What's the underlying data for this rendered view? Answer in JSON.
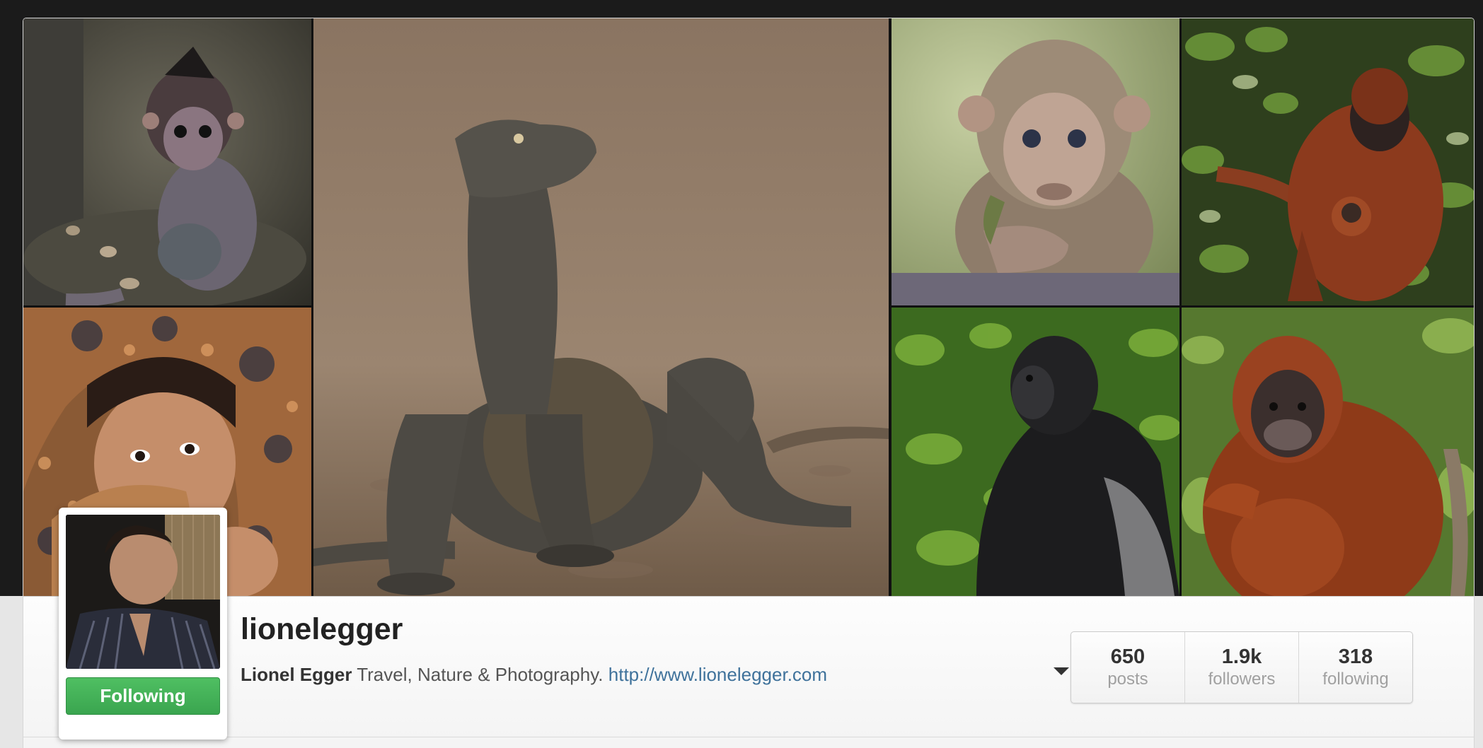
{
  "profile": {
    "username": "lionelegger",
    "full_name": "Lionel Egger",
    "bio": "Travel, Nature & Photography.",
    "website": "http://www.lionelegger.com",
    "follow_state": "Following"
  },
  "stats": [
    {
      "value": "650",
      "label": "posts"
    },
    {
      "value": "1.9k",
      "label": "followers"
    },
    {
      "value": "318",
      "label": "following"
    }
  ],
  "photos": [
    {
      "subject": "baby-macaque"
    },
    {
      "subject": "komodo-dragon"
    },
    {
      "subject": "young-macaque-eating-leaf"
    },
    {
      "subject": "orangutan-mother-with-baby"
    },
    {
      "subject": "child-under-batik-cloth"
    },
    {
      "subject": "mountain-gorilla"
    },
    {
      "subject": "orangutan-sitting"
    }
  ],
  "icons": {
    "dropdown": "caret-down-icon"
  },
  "colors": {
    "follow_button": "#3aa54f",
    "link": "#3f729b",
    "username": "#222222"
  }
}
